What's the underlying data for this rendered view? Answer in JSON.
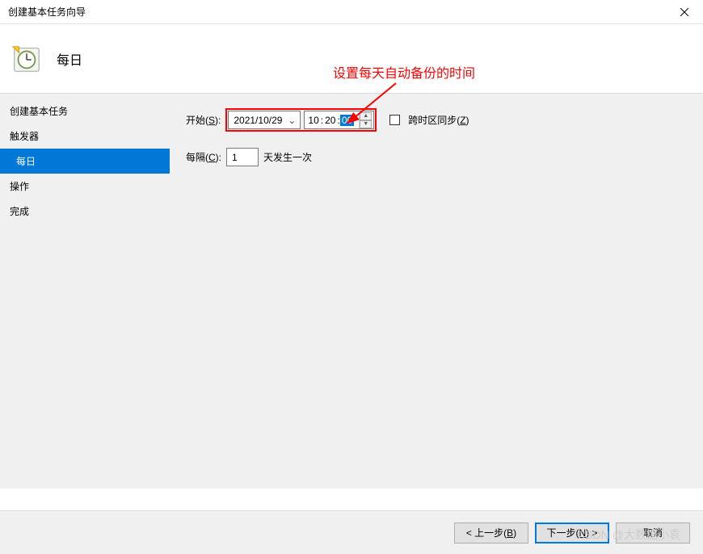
{
  "window": {
    "title": "创建基本任务向导"
  },
  "header": {
    "title": "每日"
  },
  "annotation": {
    "text": "设置每天自动备份的时间"
  },
  "sidebar": {
    "items": [
      {
        "label": "创建基本任务"
      },
      {
        "label": "触发器"
      },
      {
        "label": "每日",
        "active": true
      },
      {
        "label": "操作"
      },
      {
        "label": "完成"
      }
    ]
  },
  "form": {
    "start_label_prefix": "开始(",
    "start_label_key": "S",
    "start_label_suffix": "):",
    "date_value": "2021/10/29",
    "time_hour": "10",
    "time_min": "20",
    "time_sec": "00",
    "sync_label_prefix": "跨时区同步(",
    "sync_label_key": "Z",
    "sync_label_suffix": ")",
    "interval_label_prefix": "每隔(",
    "interval_label_key": "C",
    "interval_label_suffix": "):",
    "interval_value": "1",
    "interval_unit": "天发生一次"
  },
  "footer": {
    "back_prefix": "< 上一步(",
    "back_key": "B",
    "back_suffix": ")",
    "next_prefix": "下一步(",
    "next_key": "N",
    "next_suffix": ") >",
    "cancel": "取消"
  },
  "watermark": "CSDN @大数据小袁"
}
